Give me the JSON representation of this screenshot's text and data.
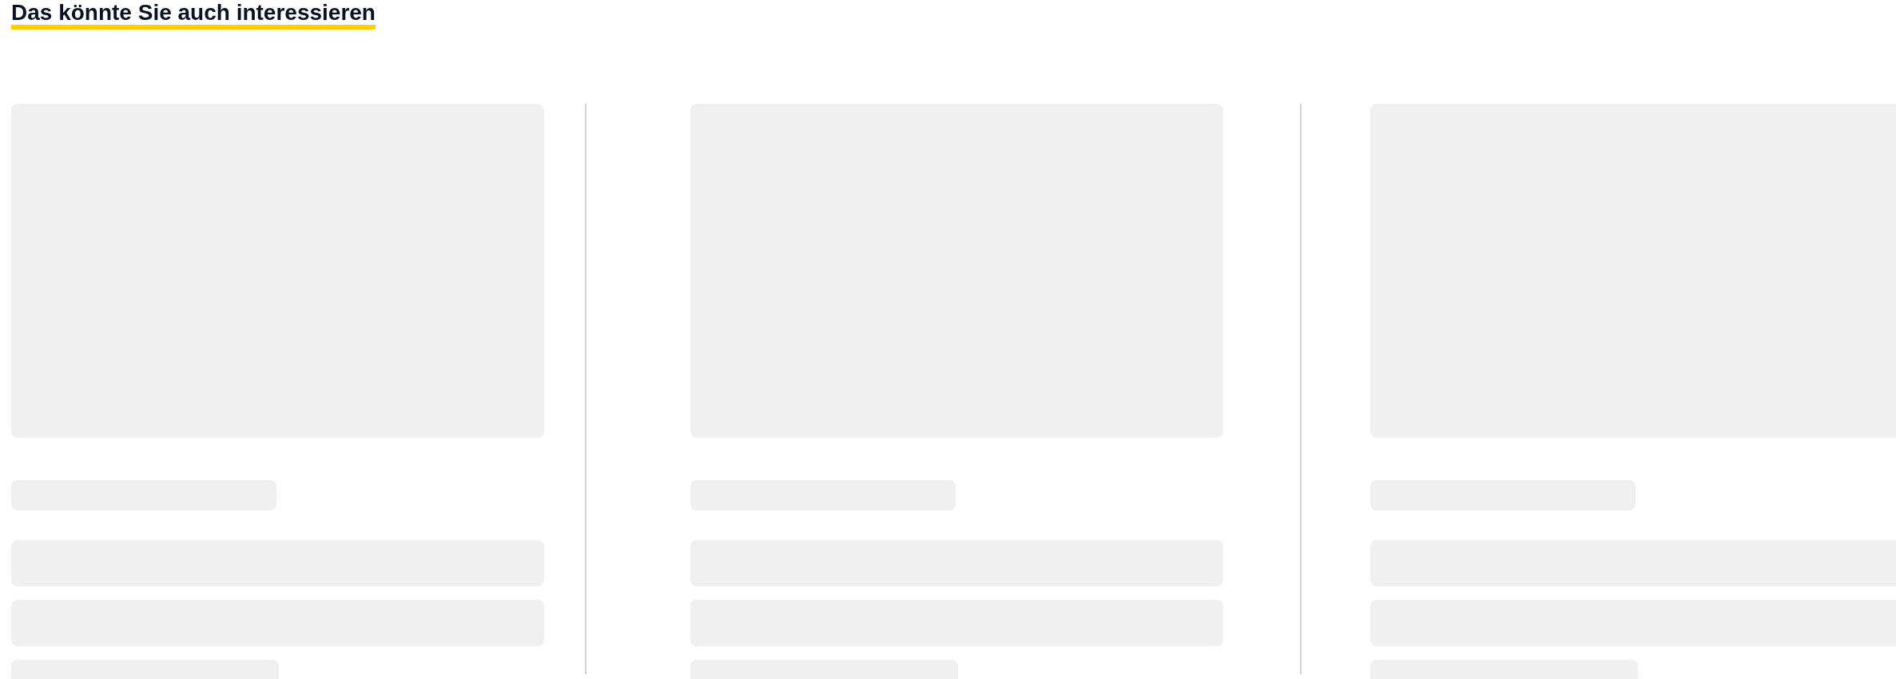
{
  "section": {
    "title": "Das könnte Sie auch interessieren"
  },
  "cards": [
    {
      "kind": "skeleton"
    },
    {
      "kind": "skeleton"
    },
    {
      "kind": "skeleton"
    }
  ]
}
